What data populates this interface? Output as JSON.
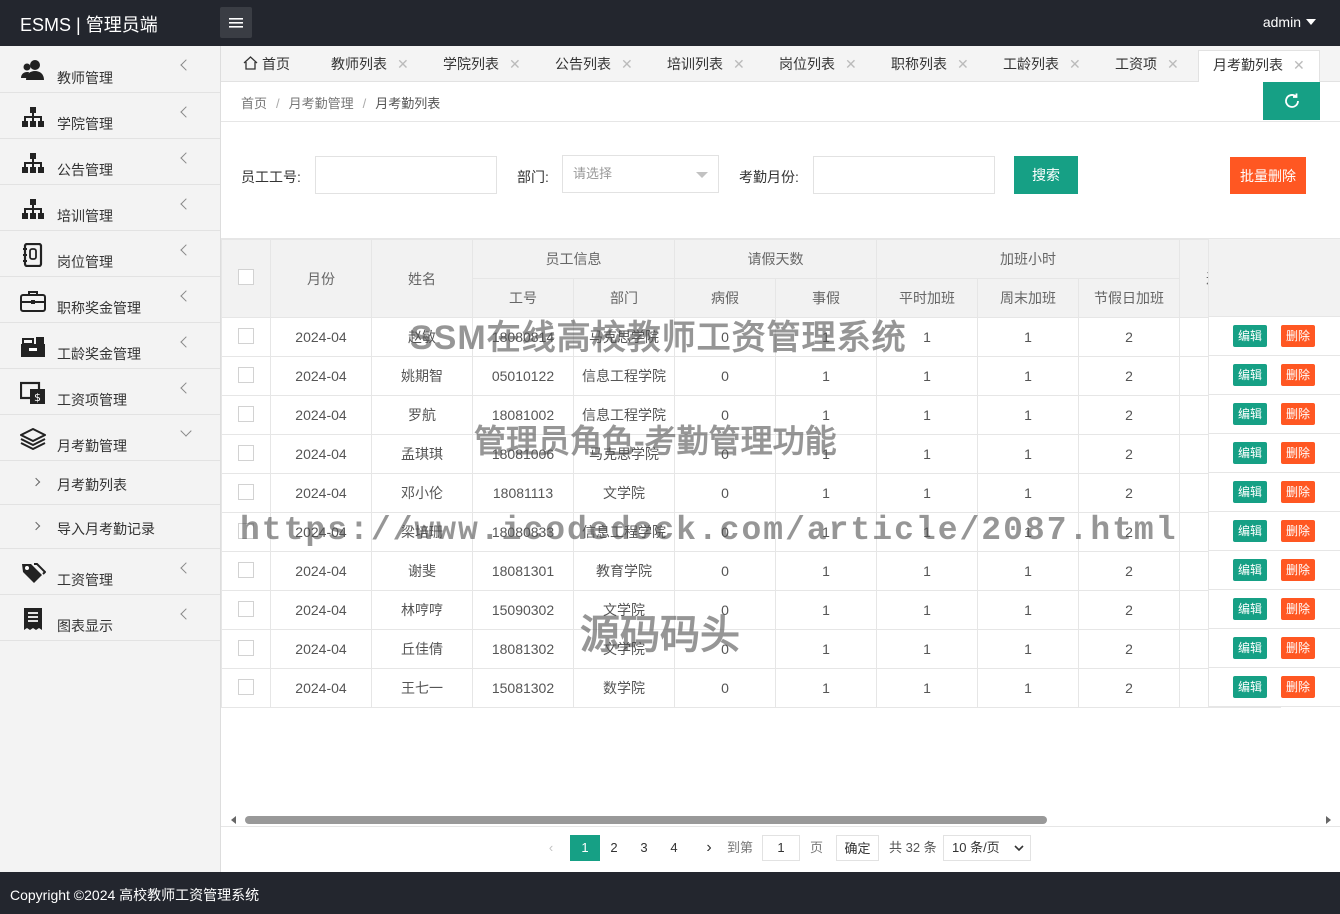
{
  "app": {
    "title": "ESMS | 管理员端",
    "user": "admin"
  },
  "sidebar": {
    "items": [
      {
        "label": "教师管理",
        "icon": "users-icon"
      },
      {
        "label": "学院管理",
        "icon": "sitemap-icon"
      },
      {
        "label": "公告管理",
        "icon": "sitemap-icon"
      },
      {
        "label": "培训管理",
        "icon": "sitemap-icon"
      },
      {
        "label": "岗位管理",
        "icon": "book-icon"
      },
      {
        "label": "职称奖金管理",
        "icon": "briefcase-icon"
      },
      {
        "label": "工龄奖金管理",
        "icon": "toolbox-icon"
      },
      {
        "label": "工资项管理",
        "icon": "money-icon"
      },
      {
        "label": "月考勤管理",
        "icon": "layers-icon"
      }
    ],
    "sub_items": [
      {
        "label": "月考勤列表"
      },
      {
        "label": "导入月考勤记录"
      }
    ],
    "items_after": [
      {
        "label": "工资管理",
        "icon": "tags-icon"
      },
      {
        "label": "图表显示",
        "icon": "receipt-icon"
      }
    ]
  },
  "tabs": [
    {
      "label": "首页"
    },
    {
      "label": "教师列表"
    },
    {
      "label": "学院列表"
    },
    {
      "label": "公告列表"
    },
    {
      "label": "培训列表"
    },
    {
      "label": "岗位列表"
    },
    {
      "label": "职称列表"
    },
    {
      "label": "工龄列表"
    },
    {
      "label": "工资项"
    },
    {
      "label": "月考勤列表"
    }
  ],
  "breadcrumb": [
    "首页",
    "月考勤管理",
    "月考勤列表"
  ],
  "filters": {
    "emp_no_label": "员工工号:",
    "dept_label": "部门:",
    "dept_placeholder": "请选择",
    "month_label": "考勤月份:",
    "search_label": "搜索",
    "batch_delete_label": "批量删除"
  },
  "table": {
    "headers": {
      "month": "月份",
      "name": "姓名",
      "emp_info": "员工信息",
      "leave_days": "请假天数",
      "overtime": "加班小时",
      "emp_no": "工号",
      "dept": "部门",
      "sick": "病假",
      "personal": "事假",
      "weekday_ot": "平时加班",
      "weekend_ot": "周末加班",
      "holiday_ot": "节假日加班",
      "extra": "迟"
    },
    "rows": [
      {
        "month": "2024-04",
        "name": "赵敏",
        "no": "18080814",
        "dept": "马克思学院",
        "sick": "0",
        "personal": "1",
        "wd": "1",
        "we": "1",
        "hd": "2"
      },
      {
        "month": "2024-04",
        "name": "姚期智",
        "no": "05010122",
        "dept": "信息工程学院",
        "sick": "0",
        "personal": "1",
        "wd": "1",
        "we": "1",
        "hd": "2"
      },
      {
        "month": "2024-04",
        "name": "罗航",
        "no": "18081002",
        "dept": "信息工程学院",
        "sick": "0",
        "personal": "1",
        "wd": "1",
        "we": "1",
        "hd": "2"
      },
      {
        "month": "2024-04",
        "name": "孟琪琪",
        "no": "18081006",
        "dept": "马克思学院",
        "sick": "0",
        "personal": "1",
        "wd": "1",
        "we": "1",
        "hd": "2"
      },
      {
        "month": "2024-04",
        "name": "邓小伦",
        "no": "18081113",
        "dept": "文学院",
        "sick": "0",
        "personal": "1",
        "wd": "1",
        "we": "1",
        "hd": "2"
      },
      {
        "month": "2024-04",
        "name": "梁培珊",
        "no": "18080833",
        "dept": "信息工程学院",
        "sick": "0",
        "personal": "1",
        "wd": "1",
        "we": "1",
        "hd": "2"
      },
      {
        "month": "2024-04",
        "name": "谢斐",
        "no": "18081301",
        "dept": "教育学院",
        "sick": "0",
        "personal": "1",
        "wd": "1",
        "we": "1",
        "hd": "2"
      },
      {
        "month": "2024-04",
        "name": "林哼哼",
        "no": "15090302",
        "dept": "文学院",
        "sick": "0",
        "personal": "1",
        "wd": "1",
        "we": "1",
        "hd": "2"
      },
      {
        "month": "2024-04",
        "name": "丘佳倩",
        "no": "18081302",
        "dept": "文学院",
        "sick": "0",
        "personal": "1",
        "wd": "1",
        "we": "1",
        "hd": "2"
      },
      {
        "month": "2024-04",
        "name": "王七一",
        "no": "15081302",
        "dept": "数学院",
        "sick": "0",
        "personal": "1",
        "wd": "1",
        "we": "1",
        "hd": "2"
      }
    ],
    "edit_label": "编辑",
    "delete_label": "删除"
  },
  "pagination": {
    "pages": [
      "1",
      "2",
      "3",
      "4"
    ],
    "goto_label": "到第",
    "goto_value": "1",
    "page_label": "页",
    "confirm_label": "确定",
    "total_label": "共 32 条",
    "page_size": "10 条/页"
  },
  "footer": {
    "copyright": "Copyright ©2024 高校教师工资管理系统"
  },
  "watermarks": {
    "title": "SSM在线高校教师工资管理系统",
    "subtitle": "管理员角色-考勤管理功能",
    "url": "https://www.icodedock.com/article/2087.html",
    "brand": "源码码头"
  },
  "colors": {
    "accent": "#16a085",
    "danger": "#ff5722",
    "header_bg": "#23262e"
  }
}
